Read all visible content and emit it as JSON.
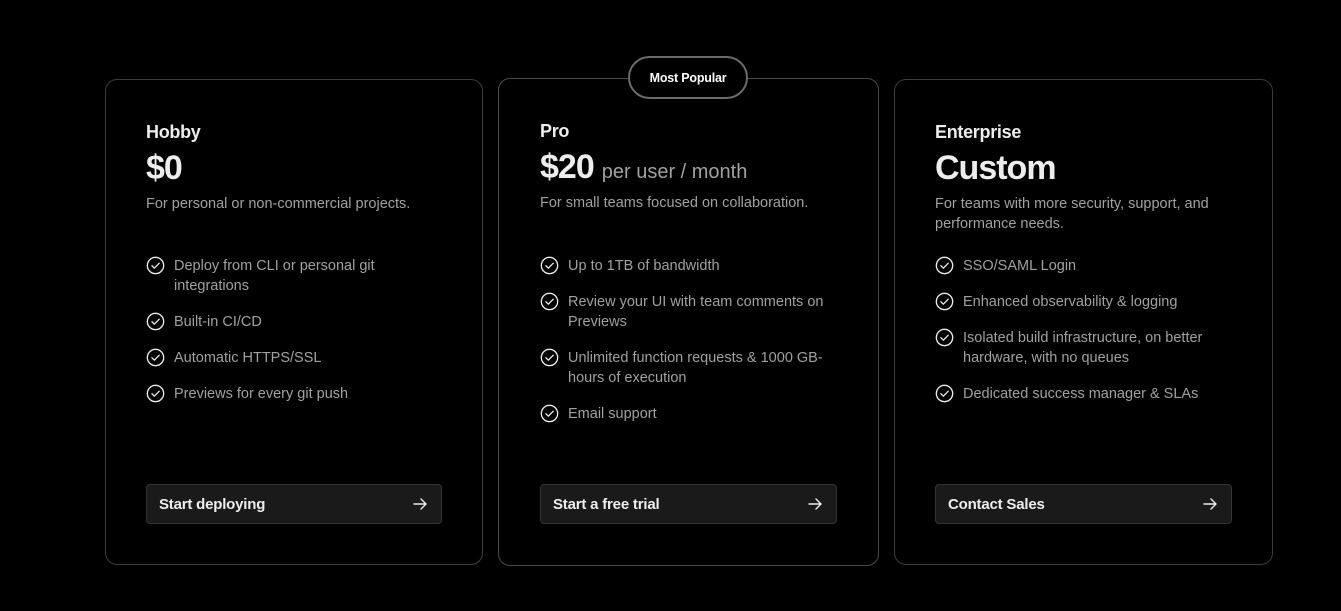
{
  "badge": {
    "label": "Most Popular"
  },
  "plans": [
    {
      "name": "Hobby",
      "price": "$0",
      "price_unit": "",
      "description": "For personal or non-commercial projects.",
      "features": [
        "Deploy from CLI or personal git integrations",
        "Built-in CI/CD",
        "Automatic HTTPS/SSL",
        "Previews for every git push"
      ],
      "cta": "Start deploying"
    },
    {
      "name": "Pro",
      "price": "$20",
      "price_unit": "per user / month",
      "description": "For small teams focused on collaboration.",
      "features": [
        "Up to 1TB of bandwidth",
        "Review your UI with team comments on Previews",
        "Unlimited function requests & 1000 GB-hours of execution",
        "Email support"
      ],
      "cta": "Start a free trial"
    },
    {
      "name": "Enterprise",
      "price": "Custom",
      "price_unit": "",
      "description": "For teams with more security, support, and performance needs.",
      "features": [
        "SSO/SAML Login",
        "Enhanced observability & logging",
        "Isolated build infrastructure, on better hardware, with no queues",
        "Dedicated success manager & SLAs"
      ],
      "cta": "Contact Sales"
    }
  ],
  "icons": {
    "feature": "check-circle-icon",
    "cta": "arrow-right-icon"
  },
  "colors": {
    "background": "#000000",
    "text_primary": "#ededed",
    "text_secondary": "#a1a1a1",
    "border": "#3d3d3d",
    "button_bg": "#1a1a1a"
  }
}
